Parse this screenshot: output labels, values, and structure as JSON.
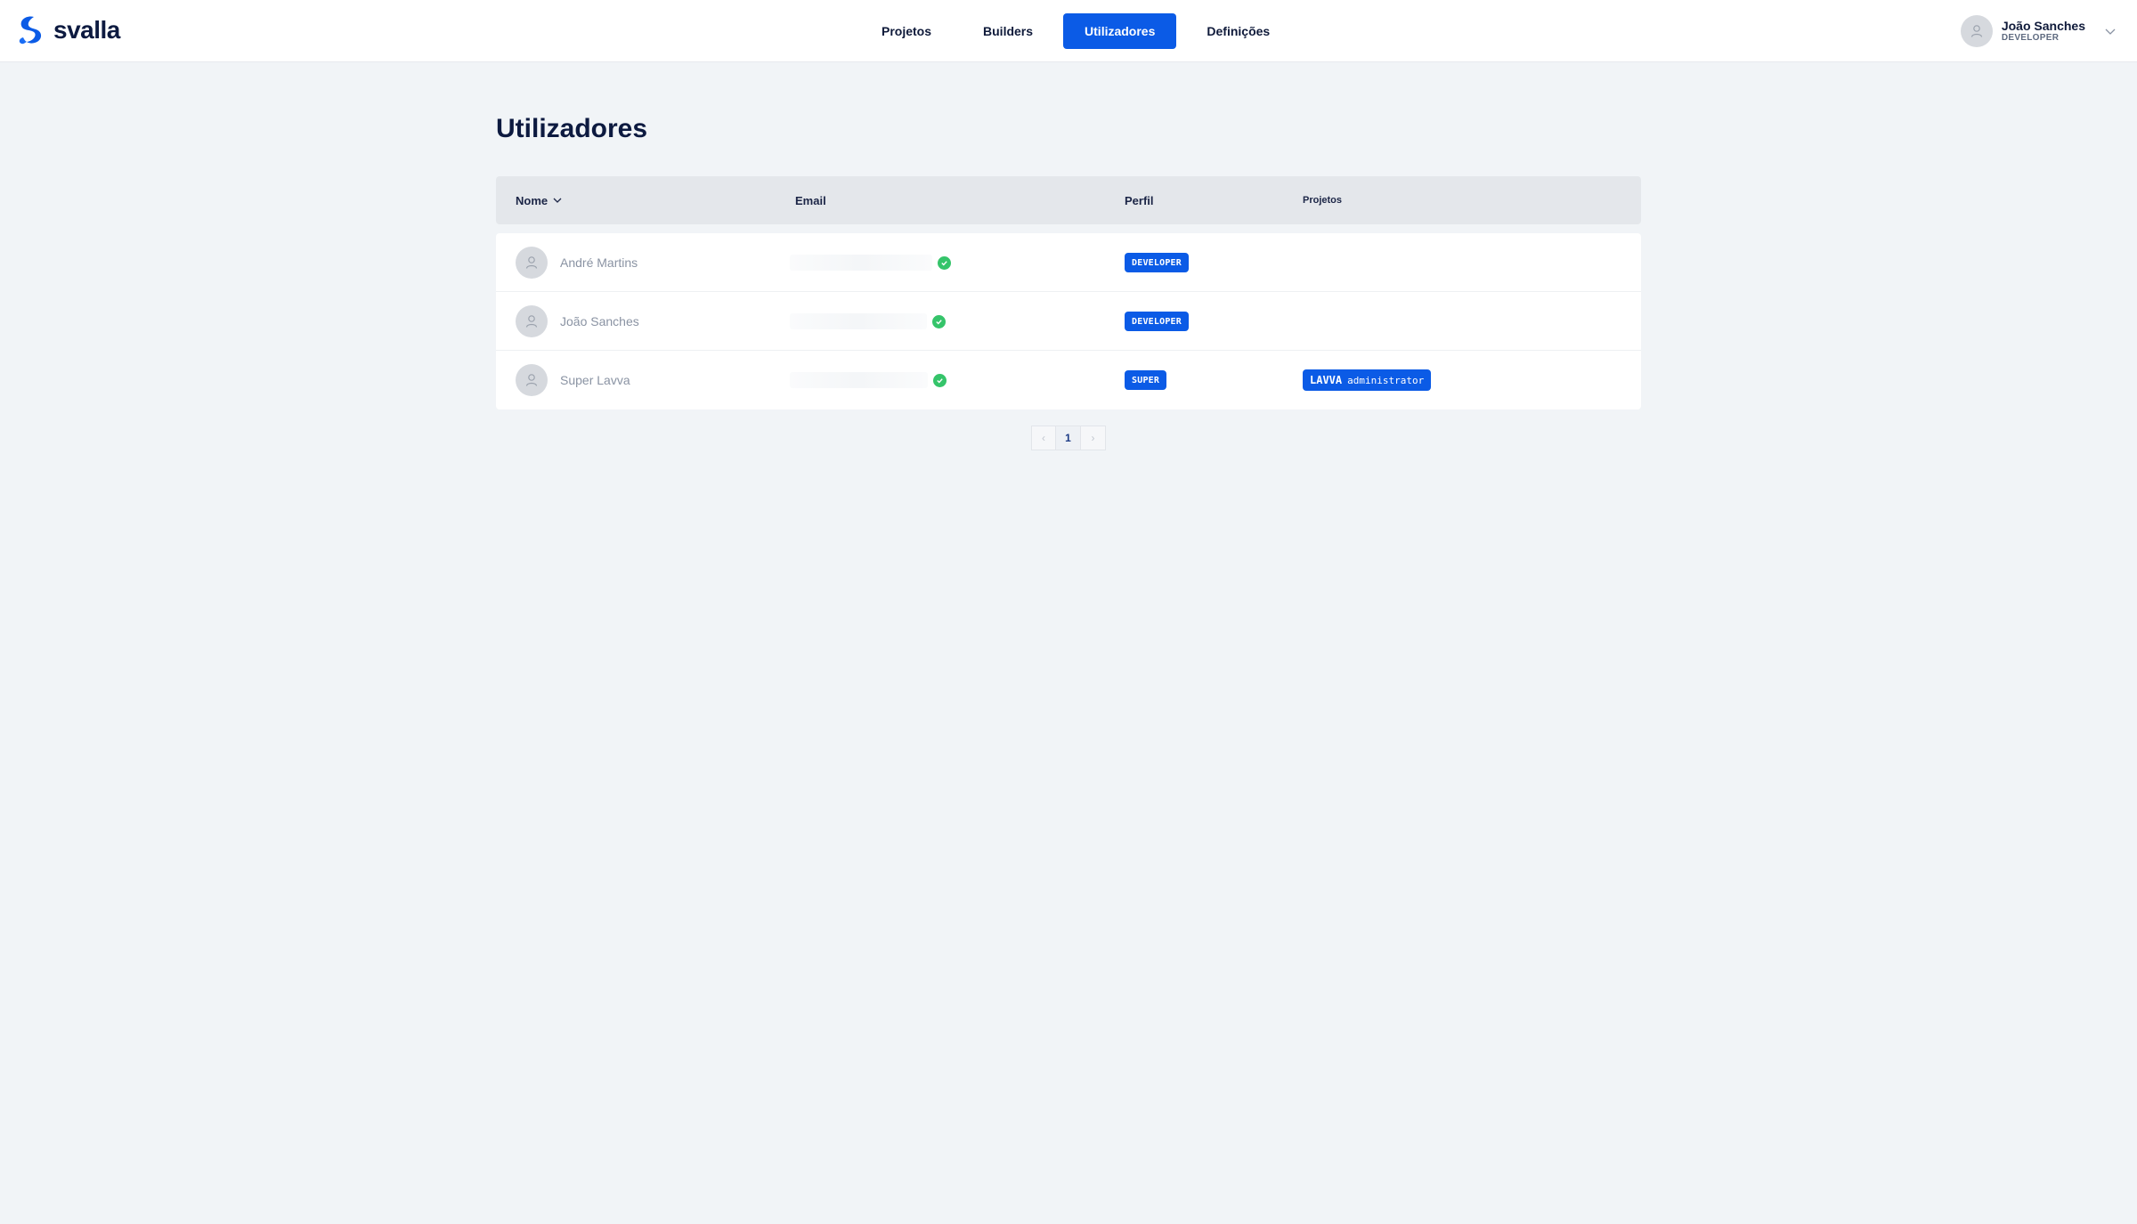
{
  "brand": {
    "name": "svalla",
    "color": "#0b5be6"
  },
  "nav": {
    "items": [
      {
        "label": "Projetos",
        "active": false
      },
      {
        "label": "Builders",
        "active": false
      },
      {
        "label": "Utilizadores",
        "active": true
      },
      {
        "label": "Definições",
        "active": false
      }
    ]
  },
  "user": {
    "name": "João Sanches",
    "role": "DEVELOPER",
    "icon": "user-icon"
  },
  "page": {
    "title": "Utilizadores"
  },
  "table": {
    "columns": {
      "name": "Nome",
      "email": "Email",
      "profile": "Perfil",
      "projects": "Projetos"
    },
    "rows": [
      {
        "name": "André Martins",
        "verified": true,
        "profile": "DEVELOPER",
        "project_name": "",
        "project_role": ""
      },
      {
        "name": "João Sanches",
        "verified": true,
        "profile": "DEVELOPER",
        "project_name": "",
        "project_role": ""
      },
      {
        "name": "Super Lavva",
        "verified": true,
        "profile": "SUPER",
        "project_name": "LAVVA",
        "project_role": "administrator"
      }
    ]
  },
  "pagination": {
    "prev": "‹",
    "current": "1",
    "next": "›"
  },
  "colors": {
    "accent": "#0b5be6",
    "verified": "#35c46a",
    "background": "#f1f4f7"
  }
}
